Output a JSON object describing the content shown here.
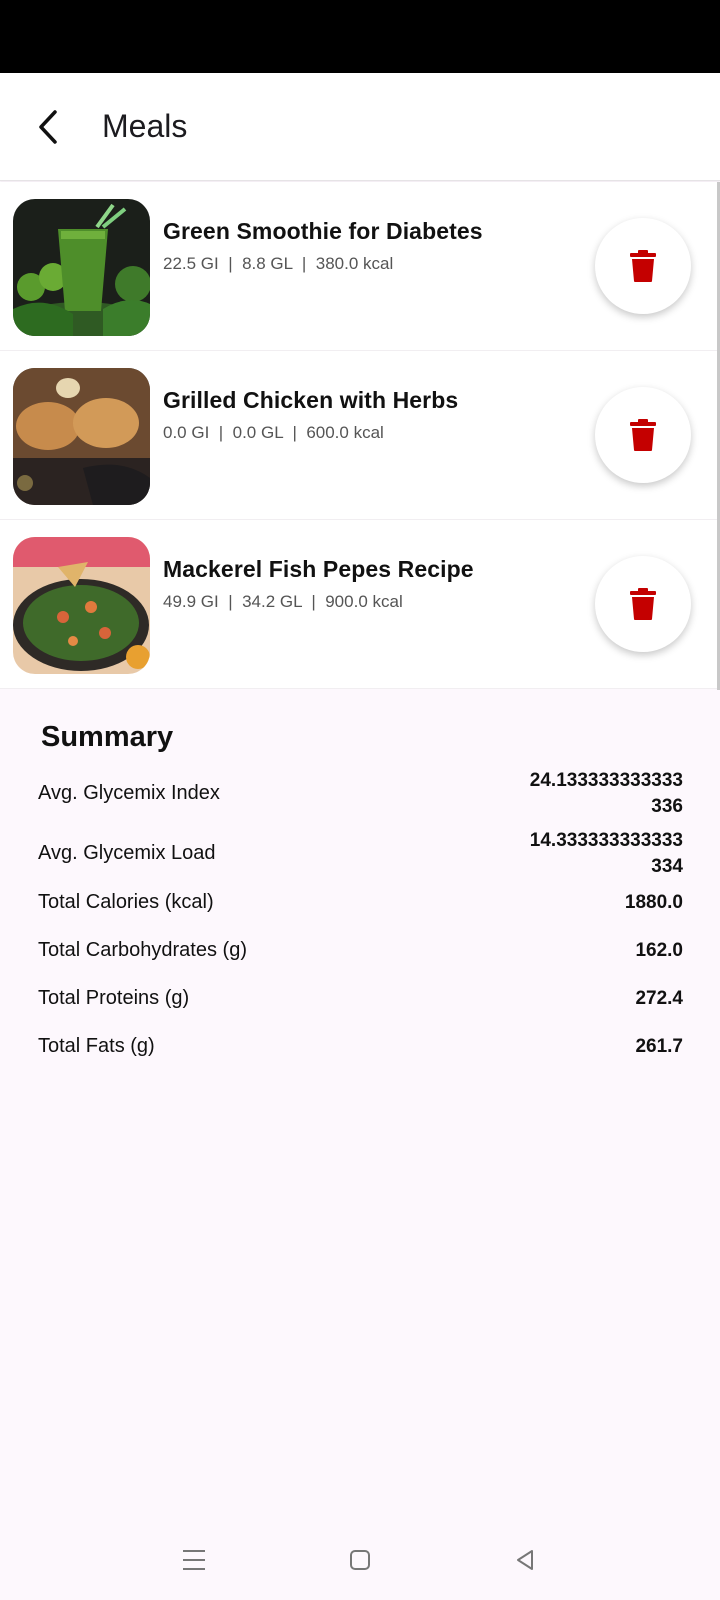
{
  "header": {
    "title": "Meals"
  },
  "meals": [
    {
      "name": "Green Smoothie for Diabetes",
      "stats": "22.5 GI  |  8.8 GL  |  380.0 kcal"
    },
    {
      "name": "Grilled Chicken with Herbs",
      "stats": "0.0 GI  |  0.0 GL  |  600.0 kcal"
    },
    {
      "name": "Mackerel Fish Pepes Recipe",
      "stats": "49.9 GI  |  34.2 GL  |  900.0 kcal"
    }
  ],
  "summary": {
    "title": "Summary",
    "rows": [
      {
        "label": "Avg. Glycemix Index",
        "value": "24.133333333333336"
      },
      {
        "label": "Avg. Glycemix Load",
        "value": "14.333333333333334"
      },
      {
        "label": "Total Calories (kcal)",
        "value": "1880.0"
      },
      {
        "label": "Total Carbohydrates (g)",
        "value": "162.0"
      },
      {
        "label": "Total Proteins (g)",
        "value": "272.4"
      },
      {
        "label": "Total Fats (g)",
        "value": "261.7"
      }
    ]
  },
  "colors": {
    "delete_red": "#c40000",
    "status_bar": "#000000",
    "background": "#fdf8fd"
  },
  "icons": {
    "back": "arrow-back-icon",
    "delete": "trash-icon",
    "nav_menu": "menu-icon",
    "nav_home": "home-square-icon",
    "nav_back": "back-triangle-icon"
  }
}
